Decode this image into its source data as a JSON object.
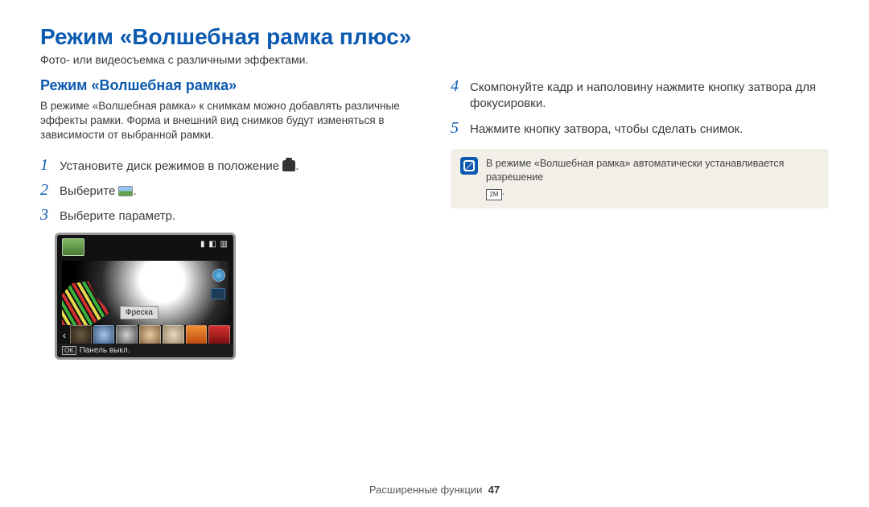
{
  "title": "Режим «Волшебная рамка плюс»",
  "subtitle": "Фото- или видеосъемка с различными эффектами.",
  "left": {
    "section_title": "Режим «Волшебная рамка»",
    "intro": "В режиме «Волшебная рамка» к снимкам можно добавлять различные эффекты рамки. Форма и внешний вид снимков будут изменяться в зависимости от выбранной рамки.",
    "steps": {
      "s1_num": "1",
      "s1_pre": "Установите диск режимов в положение ",
      "s1_post": ".",
      "s2_num": "2",
      "s2_pre": "Выберите ",
      "s2_post": ".",
      "s3_num": "3",
      "s3_text": "Выберите параметр."
    },
    "mock": {
      "tag": "Фреска",
      "ok": "OK",
      "bottom": "Панель выкл.",
      "top_right": "▮ ◧ ▥"
    }
  },
  "right": {
    "steps": {
      "s4_num": "4",
      "s4_text": "Скомпонуйте кадр и наполовину нажмите кнопку затвора для фокусировки.",
      "s5_num": "5",
      "s5_text": "Нажмите кнопку затвора, чтобы сделать снимок."
    },
    "note": "В режиме «Волшебная рамка» автоматически устанавливается разрешение ",
    "res_label": "2M"
  },
  "footer": {
    "section": "Расширенные функции",
    "page": "47"
  }
}
